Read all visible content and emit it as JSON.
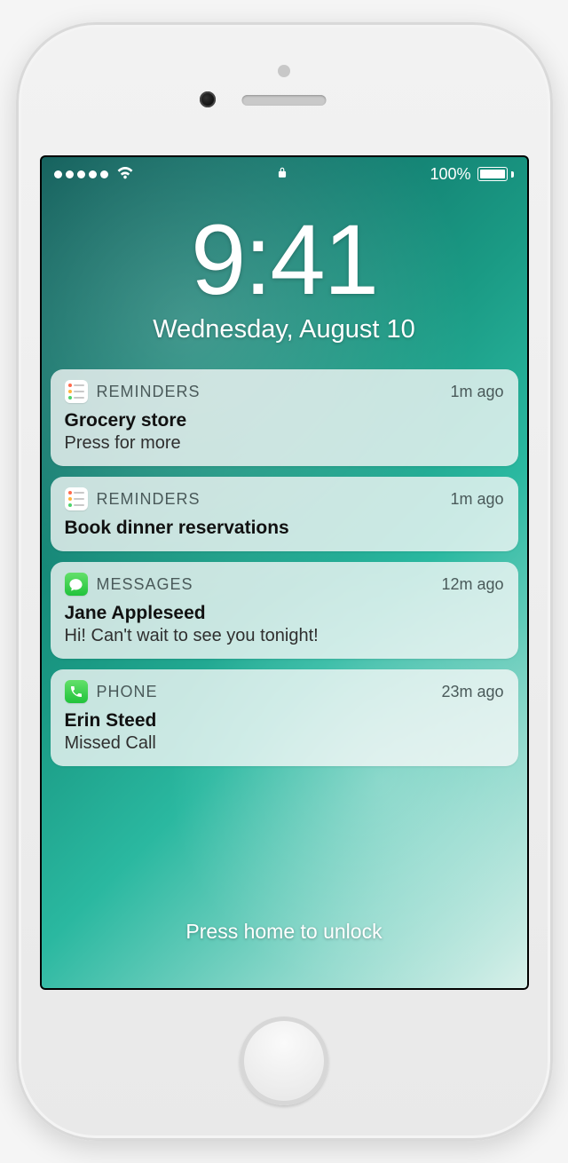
{
  "status": {
    "battery_text": "100%"
  },
  "clock": {
    "time": "9:41",
    "date": "Wednesday, August 10"
  },
  "notifications": [
    {
      "app": "REMINDERS",
      "icon": "reminders",
      "timestamp": "1m ago",
      "title": "Grocery store",
      "body": "Press for more"
    },
    {
      "app": "REMINDERS",
      "icon": "reminders",
      "timestamp": "1m ago",
      "title": "Book dinner reservations",
      "body": ""
    },
    {
      "app": "MESSAGES",
      "icon": "messages",
      "timestamp": "12m ago",
      "title": "Jane Appleseed",
      "body": "Hi! Can't wait to see you tonight!"
    },
    {
      "app": "PHONE",
      "icon": "phone",
      "timestamp": "23m ago",
      "title": "Erin Steed",
      "body": "Missed Call"
    }
  ],
  "unlock_hint": "Press home to unlock"
}
